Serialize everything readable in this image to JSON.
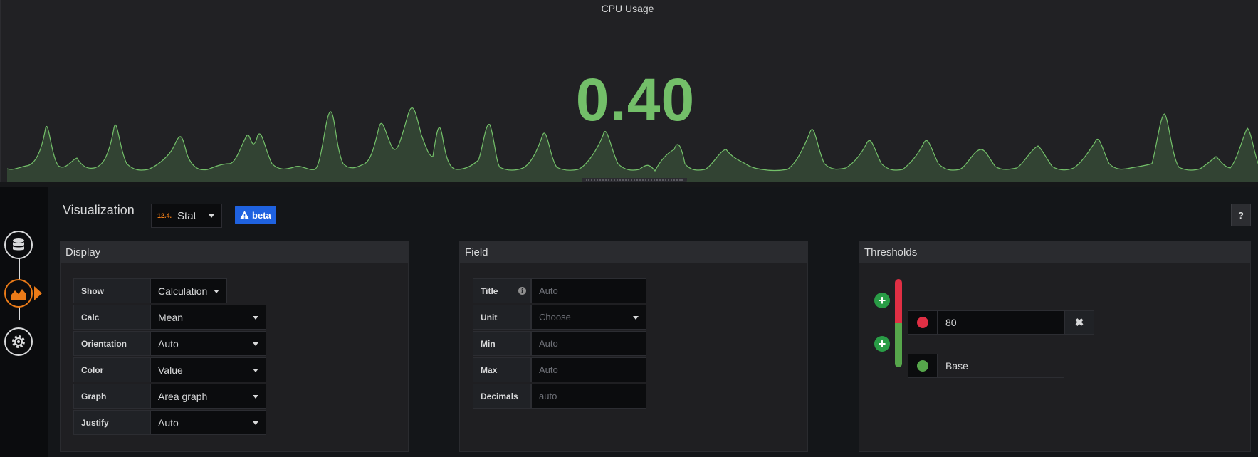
{
  "panel": {
    "title": "CPU Usage",
    "value": "0.40",
    "value_color": "#73bf69",
    "sparkline_color": "#73bf69"
  },
  "rail": {
    "items": [
      {
        "name": "queries",
        "icon": "database-icon"
      },
      {
        "name": "visualization",
        "icon": "area-chart-icon",
        "active": true
      },
      {
        "name": "general",
        "icon": "gear-icon"
      }
    ]
  },
  "viz": {
    "header": "Visualization",
    "picker_icon": "12.4.",
    "picker_label": "Stat",
    "beta_label": "beta",
    "help_label": "?"
  },
  "display": {
    "title": "Display",
    "rows": [
      {
        "label": "Show",
        "value": "Calculation"
      },
      {
        "label": "Calc",
        "value": "Mean"
      },
      {
        "label": "Orientation",
        "value": "Auto"
      },
      {
        "label": "Color",
        "value": "Value"
      },
      {
        "label": "Graph",
        "value": "Area graph"
      },
      {
        "label": "Justify",
        "value": "Auto"
      }
    ]
  },
  "field": {
    "title": "Field",
    "rows": [
      {
        "label": "Title",
        "placeholder": "Auto"
      },
      {
        "label": "Unit",
        "placeholder": "Choose"
      },
      {
        "label": "Min",
        "placeholder": "Auto"
      },
      {
        "label": "Max",
        "placeholder": "Auto"
      },
      {
        "label": "Decimals",
        "placeholder": "auto"
      }
    ]
  },
  "thresholds": {
    "title": "Thresholds",
    "items": [
      {
        "value": "80",
        "color": "#e02f44"
      },
      {
        "value": "Base",
        "color": "#56a64b"
      }
    ]
  }
}
